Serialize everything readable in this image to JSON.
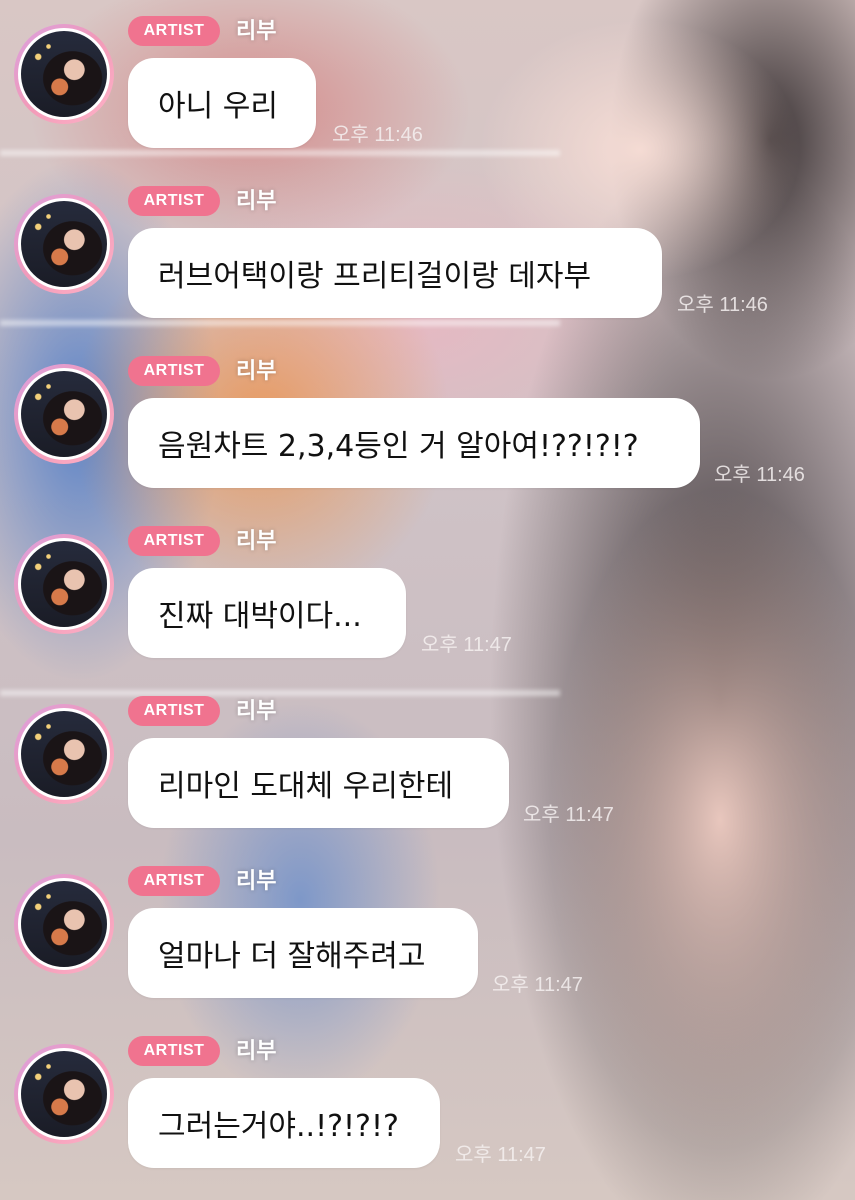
{
  "theme": {
    "badge_color": "#f0738f",
    "bubble_color": "#ffffff",
    "avatar_ring": "pink-gradient"
  },
  "messages": [
    {
      "badge": "ARTIST",
      "sender": "리부",
      "text": "아니 우리",
      "time": "오후 11:46"
    },
    {
      "badge": "ARTIST",
      "sender": "리부",
      "text": "러브어택이랑 프리티걸이랑 데자부",
      "time": "오후 11:46"
    },
    {
      "badge": "ARTIST",
      "sender": "리부",
      "text": "음원차트 2,3,4등인 거 알아여!??!?!?",
      "time": "오후 11:46"
    },
    {
      "badge": "ARTIST",
      "sender": "리부",
      "text": "진짜 대박이다...",
      "time": "오후 11:47"
    },
    {
      "badge": "ARTIST",
      "sender": "리부",
      "text": "리마인 도대체 우리한테",
      "time": "오후 11:47"
    },
    {
      "badge": "ARTIST",
      "sender": "리부",
      "text": "얼마나 더 잘해주려고",
      "time": "오후 11:47"
    },
    {
      "badge": "ARTIST",
      "sender": "리부",
      "text": "그러는거야..!?!?!?",
      "time": "오후 11:47"
    }
  ]
}
